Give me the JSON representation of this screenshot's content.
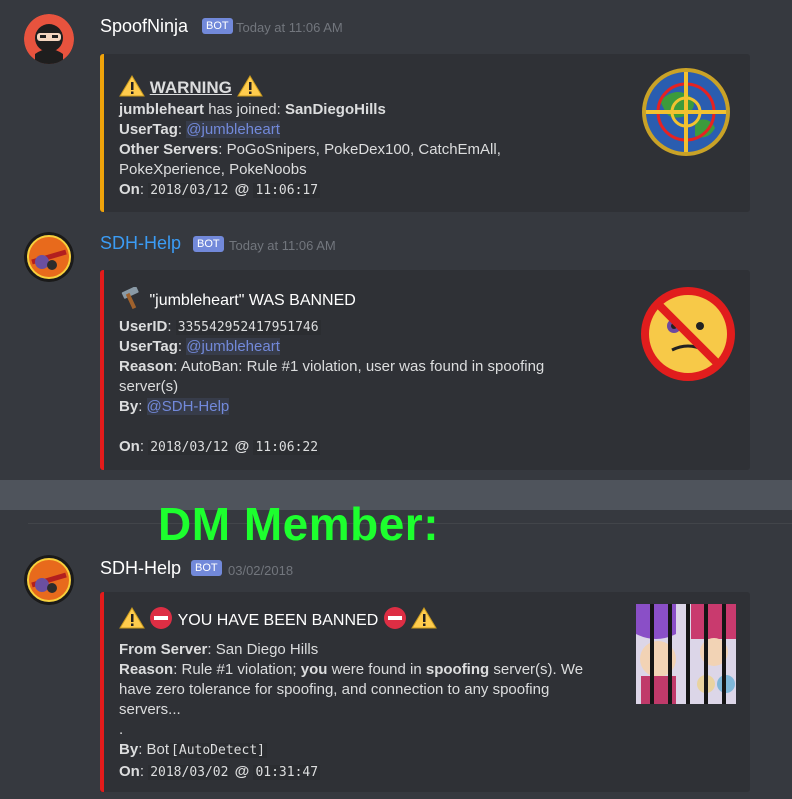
{
  "messages": [
    {
      "username": "SpoofNinja",
      "username_color": "#ffffff",
      "bot_tag": "BOT",
      "timestamp": "Today at 11:06 AM",
      "embed": {
        "accent_color": "#f0a30a",
        "title_icon": "warning-icon",
        "title": "WARNING",
        "joined_user": "jumbleheart",
        "joined_text": "has joined:",
        "joined_server": "SanDiegoHills",
        "usertag_label": "UserTag",
        "usertag_value": "@jumbleheart",
        "other_servers_label": "Other Servers",
        "other_servers_line1": "PoGoSnipers, PokeDex100, CatchEmAll,",
        "other_servers_line2": "PokeXperience, PokeNoobs",
        "on_label": "On",
        "on_date": "2018/03/12",
        "on_at": "@",
        "on_time": "11:06:17",
        "thumbnail_icon": "crosshair-globe-icon"
      }
    },
    {
      "username": "SDH-Help",
      "username_color": "#3b9cf5",
      "bot_tag": "BOT",
      "timestamp": "Today at 11:06 AM",
      "embed": {
        "accent_color": "#e31b1b",
        "title_icon": "hammer-icon",
        "title": "\"jumbleheart\" WAS BANNED",
        "userid_label": "UserID",
        "userid_value": "335542952417951746",
        "usertag_label": "UserTag",
        "usertag_value": "@jumbleheart",
        "reason_label": "Reason",
        "reason_line1": "AutoBan: Rule #1 violation, user was found in spoofing",
        "reason_line2": "server(s)",
        "by_label": "By",
        "by_value": "@SDH-Help",
        "on_label": "On",
        "on_date": "2018/03/12",
        "on_at": "@",
        "on_time": "11:06:22",
        "thumbnail_icon": "banned-face-icon"
      }
    },
    {
      "username": "SDH-Help",
      "username_color": "#ffffff",
      "bot_tag": "BOT",
      "timestamp": "03/02/2018",
      "embed": {
        "accent_color": "#e31b1b",
        "title": "YOU HAVE BEEN BANNED",
        "from_label": "From Server",
        "from_value": "San Diego Hills",
        "reason_label": "Reason",
        "reason_a": "Rule #1 violation;",
        "reason_you": "you",
        "reason_b": "were found in",
        "reason_spoofing": "spoofing",
        "reason_c": "server(s). We",
        "reason_line2": "have zero tolerance for spoofing, and connection to any spoofing",
        "reason_line3": "servers...",
        "dot": ".",
        "by_label": "By",
        "by_value": "Bot",
        "by_code": "AutoDetect",
        "on_label": "On",
        "on_date": "2018/03/02",
        "on_at": "@",
        "on_time": "01:31:47",
        "thumbnail_icon": "jailed-characters-icon"
      }
    }
  ],
  "overlay": {
    "dm_title": "DM Member:",
    "color": "#1dff2e"
  }
}
